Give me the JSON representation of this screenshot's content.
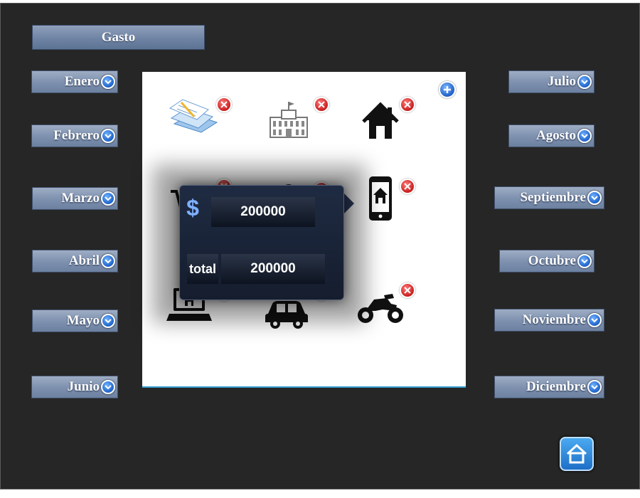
{
  "header": {
    "title": "Gasto"
  },
  "months_left": [
    {
      "label": "Enero"
    },
    {
      "label": "Febrero"
    },
    {
      "label": "Marzo"
    },
    {
      "label": "Abril"
    },
    {
      "label": "Mayo"
    },
    {
      "label": "Junio"
    }
  ],
  "months_right": [
    {
      "label": "Julio"
    },
    {
      "label": "Agosto"
    },
    {
      "label": "Septiembre"
    },
    {
      "label": "Octubre"
    },
    {
      "label": "Noviembre"
    },
    {
      "label": "Diciembre"
    }
  ],
  "categories": [
    {
      "icon": "documents-icon"
    },
    {
      "icon": "building-icon"
    },
    {
      "icon": "house-icon"
    },
    {
      "icon": "cart-icon"
    },
    {
      "icon": "person-icon"
    },
    {
      "icon": "phone-home-icon"
    },
    {
      "icon": "laptop-home-icon"
    },
    {
      "icon": "car-icon"
    },
    {
      "icon": "motorcycle-icon"
    }
  ],
  "popup": {
    "currency_symbol": "$",
    "amount": "200000",
    "total_label": "total",
    "total_value": "200000"
  },
  "colors": {
    "background": "#262626",
    "button": "#7f92b0",
    "accent_blue": "#1e63c9",
    "delete_red": "#c81e1e"
  }
}
